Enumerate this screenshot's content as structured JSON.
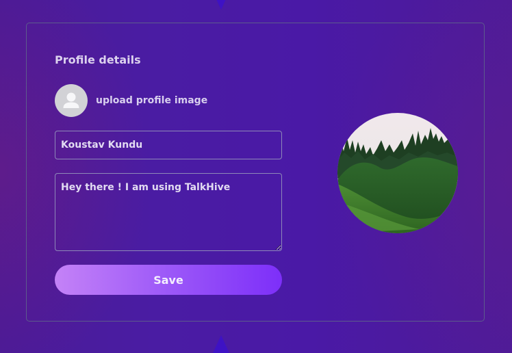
{
  "profile": {
    "title": "Profile details",
    "upload_label": "upload profile image",
    "name_value": "Koustav Kundu",
    "bio_value": "Hey there ! I am using TalkHive",
    "save_label": "Save"
  },
  "icons": {
    "avatar": "user-placeholder-icon",
    "preview": "profile-image-preview"
  },
  "colors": {
    "background": "#4a1ca3",
    "card_border": "#5d5c8c",
    "button_gradient_start": "#c482f7",
    "button_gradient_end": "#7d2ff9",
    "text": "#dcd2ee"
  }
}
